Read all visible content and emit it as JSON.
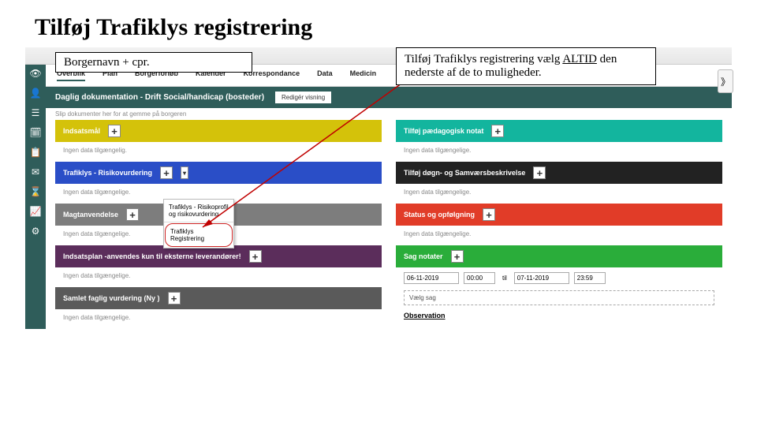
{
  "slide": {
    "title": "Tilføj Trafiklys registrering"
  },
  "annotations": {
    "left": "Borgernavn + cpr.",
    "right_a": "Tilføj Trafiklys registrering vælg ",
    "right_altid": "ALTID",
    "right_b": " den nederste af de to muligheder."
  },
  "tabs": [
    "Overblik",
    "Plan",
    "Borgerforløb",
    "Kalender",
    "Korrespondance",
    "Data",
    "Medicin"
  ],
  "section": {
    "title": "Daglig dokumentation - Drift Social/handicap (bosteder)",
    "btn": "Redigér visning"
  },
  "hint": "Slip dokumenter her for at gemme på borgeren",
  "left_col": [
    {
      "color": "c-yellow",
      "label": "Indsatsmål",
      "empty": "Ingen data tilgængelig."
    },
    {
      "color": "c-blue",
      "label": "Trafiklys - Risikovurdering",
      "empty": "Ingen data tilgængelige.",
      "dd": true
    },
    {
      "color": "c-grey",
      "label": "Magtanvendelse",
      "empty": "Ingen data tilgængelige."
    },
    {
      "color": "c-purple",
      "label": "Indsatsplan -anvendes kun til eksterne leverandører!",
      "empty": "Ingen data tilgængelige."
    },
    {
      "color": "c-dgrey",
      "label": "Samlet faglig vurdering (Ny )",
      "empty": "Ingen data tilgængelige."
    }
  ],
  "right_col": [
    {
      "color": "c-teal",
      "label": "Tilføj pædagogisk notat",
      "empty": "Ingen data tilgængelige."
    },
    {
      "color": "c-black",
      "label": "Tilføj døgn- og Samværsbeskrivelse",
      "empty": "Ingen data tilgængelige."
    },
    {
      "color": "c-red",
      "label": "Status og opfølgning",
      "empty": "Ingen data tilgængelige."
    },
    {
      "color": "c-green",
      "label": "Sag notater",
      "datebar": true
    }
  ],
  "dropdown": {
    "opt1": "Trafiklys - Risikoprofil og risikovurdering",
    "opt2": "Trafiklys Registrering"
  },
  "dates": {
    "d1": "06-11-2019",
    "t1": "00:00",
    "til": "til",
    "d2": "07-11-2019",
    "t2": "23:59",
    "search": "Vælg sag",
    "obs": "Observation"
  },
  "icons": [
    "👁",
    "👤",
    "☰",
    "🗓",
    "📋",
    "✉",
    "⌛",
    "📈",
    "⚙"
  ],
  "corner": "》"
}
